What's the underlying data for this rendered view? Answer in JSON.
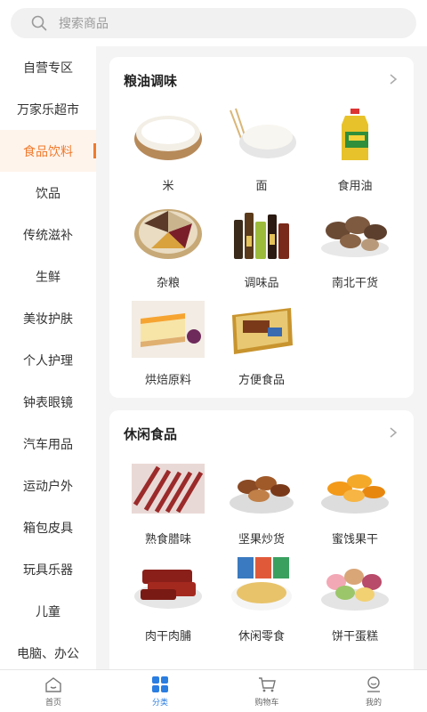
{
  "search": {
    "placeholder": "搜索商品"
  },
  "sidebar": {
    "items": [
      {
        "label": "自营专区"
      },
      {
        "label": "万家乐超市"
      },
      {
        "label": "食品饮料",
        "active": true
      },
      {
        "label": "饮品"
      },
      {
        "label": "传统滋补"
      },
      {
        "label": "生鲜"
      },
      {
        "label": "美妆护肤"
      },
      {
        "label": "个人护理"
      },
      {
        "label": "钟表眼镜"
      },
      {
        "label": "汽车用品"
      },
      {
        "label": "运动户外"
      },
      {
        "label": "箱包皮具"
      },
      {
        "label": "玩具乐器"
      },
      {
        "label": "儿童"
      },
      {
        "label": "电脑、办公"
      }
    ]
  },
  "sections": [
    {
      "title": "粮油调味",
      "items": [
        {
          "label": "米",
          "icon": "rice-icon"
        },
        {
          "label": "面",
          "icon": "flour-icon"
        },
        {
          "label": "食用油",
          "icon": "oil-icon"
        },
        {
          "label": "杂粮",
          "icon": "grains-icon"
        },
        {
          "label": "调味品",
          "icon": "condiments-icon"
        },
        {
          "label": "南北干货",
          "icon": "mushroom-icon"
        },
        {
          "label": "烘焙原料",
          "icon": "cake-icon"
        },
        {
          "label": "方便食品",
          "icon": "instant-food-icon"
        }
      ]
    },
    {
      "title": "休闲食品",
      "items": [
        {
          "label": "熟食腊味",
          "icon": "sausage-icon"
        },
        {
          "label": "坚果炒货",
          "icon": "nuts-icon"
        },
        {
          "label": "蜜饯果干",
          "icon": "dried-fruit-icon"
        },
        {
          "label": "肉干肉脯",
          "icon": "jerky-icon"
        },
        {
          "label": "休闲零食",
          "icon": "snack-icon"
        },
        {
          "label": "饼干蛋糕",
          "icon": "macaron-icon"
        }
      ]
    }
  ],
  "tabbar": {
    "items": [
      {
        "label": "首页",
        "icon": "home-icon"
      },
      {
        "label": "分类",
        "icon": "category-icon",
        "active": true
      },
      {
        "label": "购物车",
        "icon": "cart-icon"
      },
      {
        "label": "我的",
        "icon": "profile-icon"
      }
    ]
  },
  "colors": {
    "accent": "#f07a2c",
    "tab_active": "#2a7de1"
  }
}
